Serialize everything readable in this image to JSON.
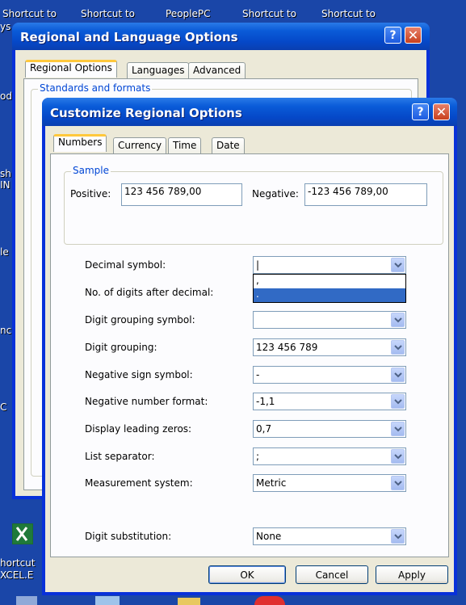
{
  "desktop": {
    "shortcuts_top": [
      "Shortcut to",
      "Shortcut to",
      "PeoplePC",
      "Shortcut to",
      "Shortcut to"
    ],
    "left_edge_fragments": [
      "ys",
      "od",
      "sh",
      "IN",
      "le",
      "nc",
      "C"
    ],
    "excel_shortcut": [
      "hortcut",
      "XCEL.E"
    ]
  },
  "regional_window": {
    "title": "Regional and Language Options",
    "help_glyph": "?",
    "close_glyph": "✕",
    "tabs": [
      "Regional Options",
      "Languages",
      "Advanced"
    ],
    "standards_group_label": "Standards and formats"
  },
  "customize_dialog": {
    "title": "Customize Regional Options",
    "help_glyph": "?",
    "close_glyph": "✕",
    "tabs": [
      "Numbers",
      "Currency",
      "Time",
      "Date"
    ],
    "active_tab": "Numbers",
    "sample": {
      "group_label": "Sample",
      "positive_label": "Positive:",
      "positive_value": "123 456 789,00",
      "negative_label": "Negative:",
      "negative_value": "-123 456 789,00"
    },
    "fields": [
      {
        "label": "Decimal symbol:",
        "value": "|"
      },
      {
        "label": "No. of digits after decimal:",
        "value": ""
      },
      {
        "label": "Digit grouping symbol:",
        "value": ""
      },
      {
        "label": "Digit grouping:",
        "value": "123 456 789"
      },
      {
        "label": "Negative sign symbol:",
        "value": "-"
      },
      {
        "label": "Negative number format:",
        "value": "-1,1"
      },
      {
        "label": "Display leading zeros:",
        "value": "0,7"
      },
      {
        "label": "List separator:",
        "value": ";"
      },
      {
        "label": "Measurement system:",
        "value": "Metric"
      },
      {
        "label": "Digit substitution:",
        "value": "None"
      }
    ],
    "decimal_dropdown_options": [
      ",",
      "."
    ],
    "decimal_dropdown_selected_index": 1,
    "buttons": {
      "ok": "OK",
      "cancel": "Cancel",
      "apply": "Apply"
    }
  }
}
